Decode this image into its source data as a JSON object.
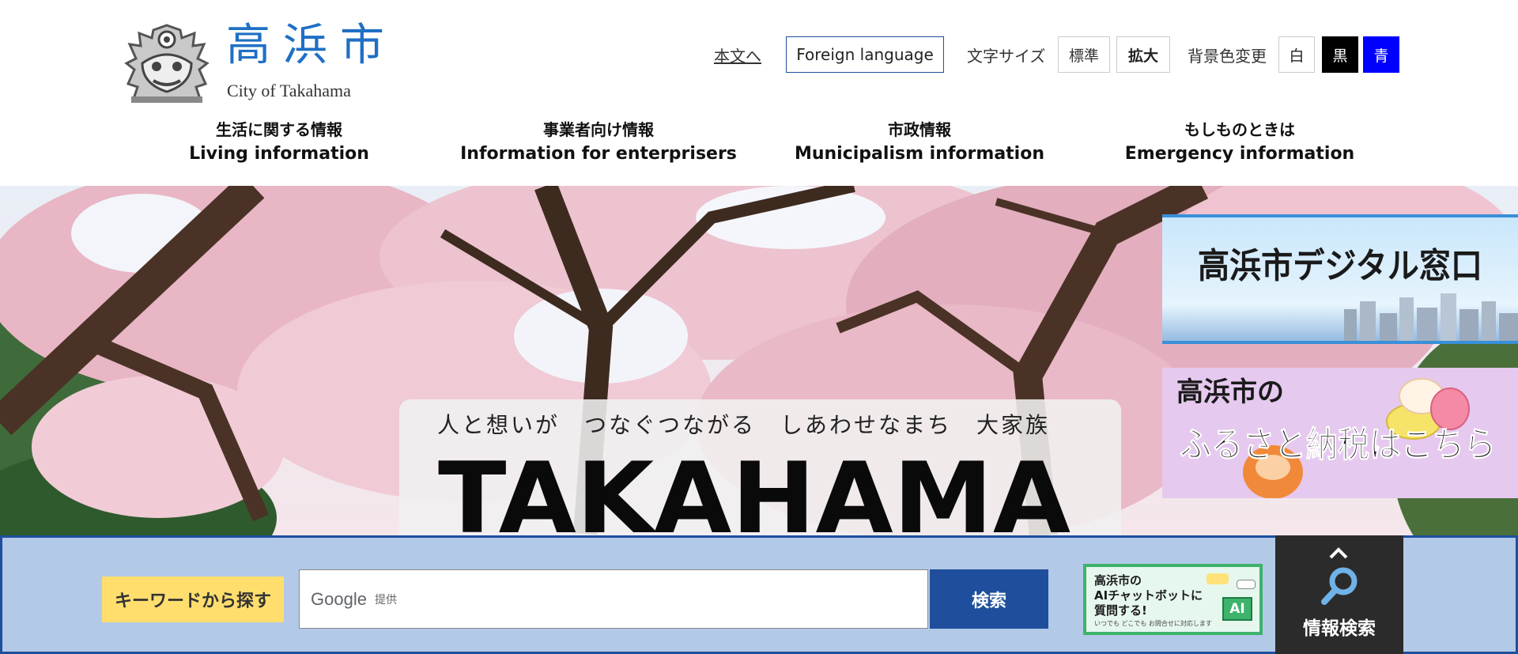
{
  "header": {
    "logo_title": "高浜市",
    "logo_subtitle": "City of Takahama",
    "skip_link": "本文へ",
    "foreign_language": "Foreign language",
    "font_size_label": "文字サイズ",
    "font_size_standard": "標準",
    "font_size_large": "拡大",
    "bg_color_label": "背景色変更",
    "bg_white": "白",
    "bg_black": "黒",
    "bg_blue": "青"
  },
  "nav": {
    "items": [
      {
        "jp": "生活に関する情報",
        "en": "Living information"
      },
      {
        "jp": "事業者向け情報",
        "en": "Information for enterprisers"
      },
      {
        "jp": "市政情報",
        "en": "Municipalism information"
      },
      {
        "jp": "もしものときは",
        "en": "Emergency information"
      }
    ]
  },
  "hero": {
    "slogan": "人と想いが　つなぐつながる　しあわせなまち　大家族",
    "brand": "TAKAHAMA",
    "banner_digital": "高浜市デジタル窓口",
    "banner_furusato_line1": "高浜市の",
    "banner_furusato_line2": "ふるさと納税はこちら"
  },
  "search": {
    "keyword_label": "キーワードから探す",
    "google_logo": "Google",
    "provided_by": "提供",
    "search_button": "検索",
    "ai_banner_text": "高浜市の\nAIチャットボットに\n質問する!",
    "ai_banner_note": "いつでも どこでも お問合せに対応します",
    "ai_badge": "AI",
    "info_search_label": "情報検索"
  },
  "colors": {
    "accent_blue": "#1f4f9c",
    "logo_blue": "#1f6fc5",
    "keyword_yellow": "#ffde6e",
    "search_bar_bg": "#b3c9e8"
  }
}
